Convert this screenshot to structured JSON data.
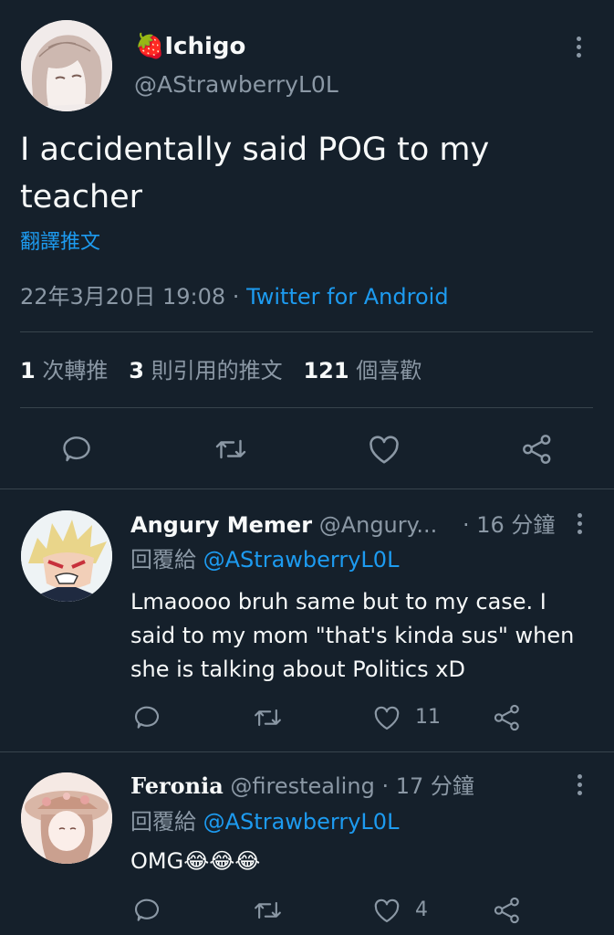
{
  "main_tweet": {
    "avatar_icon": "anime-girl-avatar-icon",
    "name_emoji": "🍓",
    "name": "Ichigo",
    "handle": "@AStrawberryL0L",
    "text_line1": "I accidentally said POG to my",
    "text_line2": "teacher",
    "translate_label": "翻譯推文",
    "timestamp": "22年3月20日 19:08",
    "separator": "·",
    "source": "Twitter for Android",
    "stats": {
      "retweets_count": "1",
      "retweets_label": "次轉推",
      "quotes_count": "3",
      "quotes_label": "則引用的推文",
      "likes_count": "121",
      "likes_label": "個喜歡"
    }
  },
  "replies": [
    {
      "avatar_icon": "anime-boy-avatar-icon",
      "name": "Angury Memer",
      "handle": "@Angury...",
      "time": "· 16 分鐘",
      "reply_to_label": "回覆給",
      "reply_to_handle": "@AStrawberryL0L",
      "text_lines": [
        "Lmaoooo bruh same but to my case. I",
        "said to my mom \"that's kinda sus\" when",
        "she is talking about Politics xD"
      ],
      "like_count": "11"
    },
    {
      "avatar_icon": "anime-girl-hat-avatar-icon",
      "name": "Feronia",
      "handle": "@firestealing",
      "time": "· 17 分鐘",
      "reply_to_label": "回覆給",
      "reply_to_handle": "@AStrawberryL0L",
      "text": "OMG😂😂😂",
      "like_count": "4"
    }
  ],
  "colors": {
    "background": "#15202b",
    "text": "#f7f9f9",
    "muted": "#8b98a5",
    "accent": "#1d9bf0",
    "divider": "#38444d"
  }
}
